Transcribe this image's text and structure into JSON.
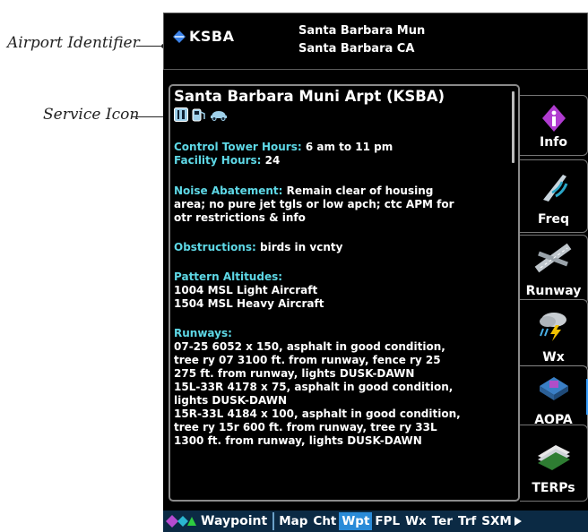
{
  "callouts": {
    "airport_identifier": "Airport Identifier",
    "service_icon": "Service Icon"
  },
  "header": {
    "identifier": "KSBA",
    "name_line1": "Santa Barbara Mun",
    "name_line2": "Santa Barbara CA"
  },
  "info": {
    "airport_name": "Santa Barbara Muni Arpt (KSBA)",
    "service_icons": [
      "food-icon",
      "fuel-icon",
      "car-rental-icon"
    ],
    "tower_label": "Control Tower Hours:",
    "tower_value": "6 am to 11 pm",
    "facility_label": "Facility Hours:",
    "facility_value": "24",
    "noise_label": "Noise Abatement:",
    "noise_l1": "Remain clear of housing",
    "noise_l2": "area; no pure jet tgls or low apch; ctc APM for",
    "noise_l3": "otr restrictions & info",
    "obst_label": "Obstructions:",
    "obst_value": "birds in vcnty",
    "pattern_label": "Pattern Altitudes:",
    "pattern_l1": "1004 MSL Light Aircraft",
    "pattern_l2": "1504 MSL Heavy Aircraft",
    "runways_label": "Runways:",
    "runway_lines": [
      "07-25 6052 x 150, asphalt in good condition,",
      "tree ry 07 3100 ft. from runway, fence ry 25",
      "275 ft. from runway, lights DUSK-DAWN",
      "15L-33R 4178 x 75, asphalt in good condition,",
      "lights DUSK-DAWN",
      "15R-33L 4184 x 100, asphalt in good condition,",
      "tree ry 15r 600 ft. from runway, tree ry 33L",
      "1300 ft. from runway, lights DUSK-DAWN"
    ]
  },
  "tabs": [
    {
      "label": "Info",
      "icon": "info-icon"
    },
    {
      "label": "Freq",
      "icon": "frequency-icon"
    },
    {
      "label": "Runway",
      "icon": "runway-icon"
    },
    {
      "label": "Wx",
      "icon": "weather-icon"
    },
    {
      "label": "AOPA",
      "icon": "aopa-icon"
    },
    {
      "label": "TERPs",
      "icon": "terps-icon"
    }
  ],
  "bottombar": {
    "title": "Waypoint",
    "items": [
      "Map",
      "Cht",
      "Wpt",
      "FPL",
      "Wx",
      "Ter",
      "Trf",
      "SXM"
    ],
    "active": "Wpt"
  },
  "colors": {
    "label_cyan": "#5ed8e6",
    "active_blue": "#2a8bd8",
    "bar_navy": "#0b2a44"
  }
}
